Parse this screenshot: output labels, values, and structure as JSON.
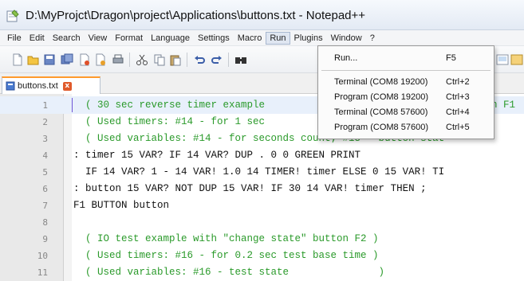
{
  "window": {
    "title": "D:\\MyProjct\\Dragon\\project\\Applications\\buttons.txt - Notepad++"
  },
  "menubar": {
    "items": [
      "File",
      "Edit",
      "Search",
      "View",
      "Format",
      "Language",
      "Settings",
      "Macro",
      "Run",
      "Plugins",
      "Window",
      "?"
    ],
    "active": "Run"
  },
  "tab": {
    "label": "buttons.txt",
    "close": "x"
  },
  "run_menu": {
    "run": {
      "label": "Run...",
      "shortcut": "F5"
    },
    "entries": [
      {
        "label": "Terminal (COM8 19200)",
        "shortcut": "Ctrl+2"
      },
      {
        "label": "Program (COM8 19200)",
        "shortcut": "Ctrl+3"
      },
      {
        "label": "Terminal (COM8 57600)",
        "shortcut": "Ctrl+4"
      },
      {
        "label": "Program (COM8 57600)",
        "shortcut": "Ctrl+5"
      }
    ]
  },
  "editor": {
    "lines": [
      {
        "n": "1",
        "text": "  ( 30 sec reverse timer example ",
        "tail": "n F1",
        "kind": "comment"
      },
      {
        "n": "2",
        "text": "  ( Used timers: #14 - for 1 sec ",
        "kind": "comment"
      },
      {
        "n": "3",
        "text": "  ( Used variables: #14 - for seconds count; #15 - button stat",
        "kind": "comment"
      },
      {
        "n": "4",
        "text": ": timer 15 VAR? IF 14 VAR? DUP . 0 0 GREEN PRINT",
        "kind": "normal"
      },
      {
        "n": "5",
        "text": "  IF 14 VAR? 1 - 14 VAR! 1.0 14 TIMER! timer ELSE 0 15 VAR! TI",
        "kind": "normal"
      },
      {
        "n": "6",
        "text": ": button 15 VAR? NOT DUP 15 VAR! IF 30 14 VAR! timer THEN ;",
        "kind": "normal"
      },
      {
        "n": "7",
        "text": "F1 BUTTON button",
        "kind": "normal"
      },
      {
        "n": "8",
        "text": "",
        "kind": "normal"
      },
      {
        "n": "9",
        "text": "  ( IO test example with \"change state\" button F2 )",
        "kind": "comment"
      },
      {
        "n": "10",
        "text": "  ( Used timers: #16 - for 0.2 sec test base time )",
        "kind": "comment"
      },
      {
        "n": "11",
        "text": "  ( Used variables: #16 - test state               )",
        "kind": "comment"
      }
    ]
  },
  "colors": {
    "comment": "#2a9a2a",
    "code": "#111111",
    "tab_accent": "#ff9a2c"
  }
}
